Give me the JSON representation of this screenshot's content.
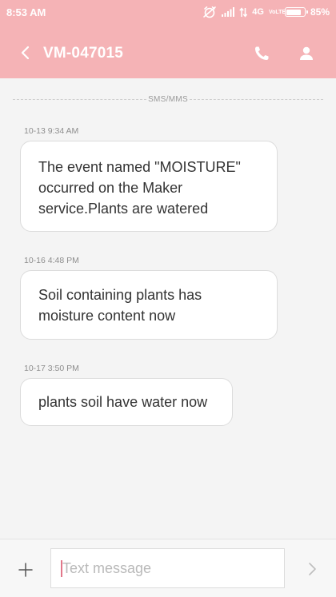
{
  "status_bar": {
    "time": "8:53 AM",
    "network": "4G",
    "volte": "VoLTE",
    "battery_text": "85%",
    "battery_level": 0.85,
    "icons": [
      "alarm-off-icon",
      "signal-icon",
      "data-arrows-icon",
      "volte-icon",
      "battery-icon"
    ]
  },
  "header": {
    "contact": "VM-047015",
    "icons": [
      "chevron-left-icon",
      "phone-icon",
      "person-icon"
    ]
  },
  "conversation": {
    "channel_label": "SMS/MMS",
    "messages": [
      {
        "time": "10-13 9:34 AM",
        "lines": [
          "The event named \"MOISTURE\"",
          "occurred on the Maker",
          "service.Plants are watered"
        ]
      },
      {
        "time": "10-16 4:48 PM",
        "lines": [
          "Soil containing plants has",
          "moisture content now"
        ]
      },
      {
        "time": "10-17 3:50 PM",
        "lines": [
          "plants soil have water now"
        ]
      }
    ]
  },
  "composer": {
    "placeholder": "Text message",
    "value": "",
    "icons": [
      "plus-icon",
      "send-arrow-icon"
    ]
  },
  "colors": {
    "header_background": "#f5b3b6",
    "page_background": "#f4f4f4",
    "bubble_background": "#ffffff",
    "caret": "#e2778a"
  }
}
